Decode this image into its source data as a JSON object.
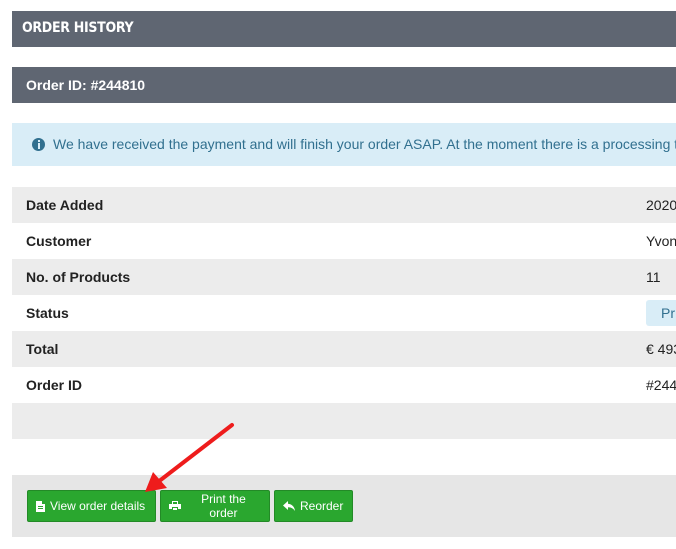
{
  "section_title": "ORDER HISTORY",
  "order_header": "Order ID: #244810",
  "alert": {
    "icon": "info-circle-icon",
    "text": "We have received the payment and will finish your order ASAP. At the moment there is a processing time of"
  },
  "details": {
    "date_added": {
      "label": "Date Added",
      "value": "2020"
    },
    "customer": {
      "label": "Customer",
      "value": "Yvonne"
    },
    "products": {
      "label": "No. of Products",
      "value": "11"
    },
    "status": {
      "label": "Status",
      "value": "Pr"
    },
    "total": {
      "label": "Total",
      "value": "€ 493"
    },
    "order_id": {
      "label": "Order ID",
      "value": "#244"
    }
  },
  "buttons": {
    "view": {
      "label": "View order details",
      "icon": "file-icon"
    },
    "print": {
      "label": "Print the order",
      "icon": "printer-icon"
    },
    "reorder": {
      "label": "Reorder",
      "icon": "reply-icon"
    }
  },
  "colors": {
    "header_bar": "#5f6672",
    "alert_bg": "#d9edf7",
    "alert_text": "#31708f",
    "button_green": "#2aa72f",
    "arrow_red": "#ee1c1c"
  }
}
